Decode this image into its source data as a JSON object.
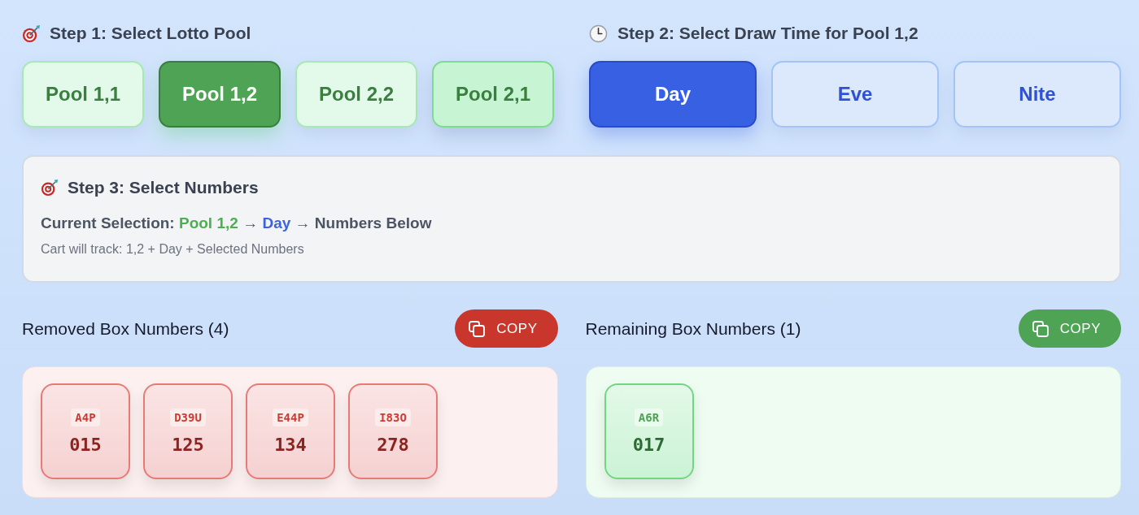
{
  "step1": {
    "title": "Step 1: Select Lotto Pool",
    "pools": [
      {
        "label": "Pool 1,1",
        "selected": false,
        "hovered": false
      },
      {
        "label": "Pool 1,2",
        "selected": true,
        "hovered": false
      },
      {
        "label": "Pool 2,2",
        "selected": false,
        "hovered": false
      },
      {
        "label": "Pool 2,1",
        "selected": false,
        "hovered": true
      }
    ]
  },
  "step2": {
    "title": "Step 2: Select Draw Time for Pool 1,2",
    "times": [
      {
        "label": "Day",
        "selected": true
      },
      {
        "label": "Eve",
        "selected": false
      },
      {
        "label": "Nite",
        "selected": false
      }
    ]
  },
  "step3": {
    "title": "Step 3: Select Numbers",
    "current_selection": [
      {
        "kind": "label",
        "text": "Current Selection:"
      },
      {
        "kind": "pool",
        "text": "Pool 1,2"
      },
      {
        "kind": "plain",
        "text": "→"
      },
      {
        "kind": "time",
        "text": "Day"
      },
      {
        "kind": "plain",
        "text": "→ Numbers Below"
      }
    ],
    "note": "Cart will track: 1,2 + Day + Selected Numbers"
  },
  "box_lists": [
    {
      "kind": "removed",
      "title": "Removed Box Numbers (4)",
      "copy_button": "COPY",
      "boxes": [
        {
          "code": "A4P",
          "number": "015"
        },
        {
          "code": "D39U",
          "number": "125"
        },
        {
          "code": "E44P",
          "number": "134"
        },
        {
          "code": "I83O",
          "number": "278"
        }
      ]
    },
    {
      "kind": "remaining",
      "title": "Remaining Box Numbers (1)",
      "copy_button": "COPY",
      "boxes": [
        {
          "code": "A6R",
          "number": "017"
        }
      ]
    }
  ]
}
